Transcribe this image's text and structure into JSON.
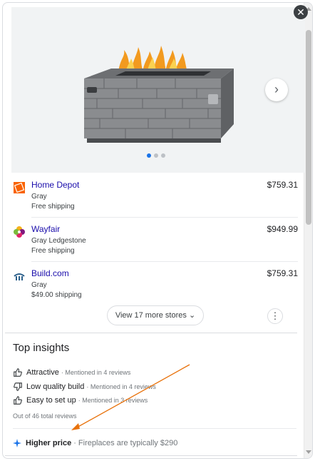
{
  "close": {
    "glyph": "✕"
  },
  "carousel": {
    "next_glyph": "›",
    "dots": 3,
    "active_dot": 0
  },
  "stores": [
    {
      "name": "Home Depot",
      "variant": "Gray",
      "shipping": "Free shipping",
      "price": "$759.31",
      "logo": "home-depot-logo"
    },
    {
      "name": "Wayfair",
      "variant": "Gray Ledgestone",
      "shipping": "Free shipping",
      "price": "$949.99",
      "logo": "wayfair-logo"
    },
    {
      "name": "Build.com",
      "variant": "Gray",
      "shipping": "$49.00 shipping",
      "price": "$759.31",
      "logo": "build-com-logo"
    }
  ],
  "more_stores": {
    "label": "View 17 more stores",
    "glyph": "⌄"
  },
  "kebab": {
    "glyph": "⋮"
  },
  "insights": {
    "title": "Top insights",
    "items": [
      {
        "label": "Attractive",
        "meta": "· Mentioned in 4 reviews",
        "icon": "thumbs-up-icon"
      },
      {
        "label": "Low quality build",
        "meta": "· Mentioned in 4 reviews",
        "icon": "thumbs-down-icon"
      },
      {
        "label": "Easy to set up",
        "meta": "· Mentioned in 3 reviews",
        "icon": "thumbs-up-icon"
      }
    ],
    "total": "Out of 46 total reviews",
    "price_insight": {
      "label": "Higher price",
      "meta": "· Fireplaces are typically $290",
      "icon": "sparkle-icon"
    }
  },
  "colors": {
    "link": "#1a0dab",
    "accent": "#1a73e8",
    "annotation": "#e8710a"
  }
}
